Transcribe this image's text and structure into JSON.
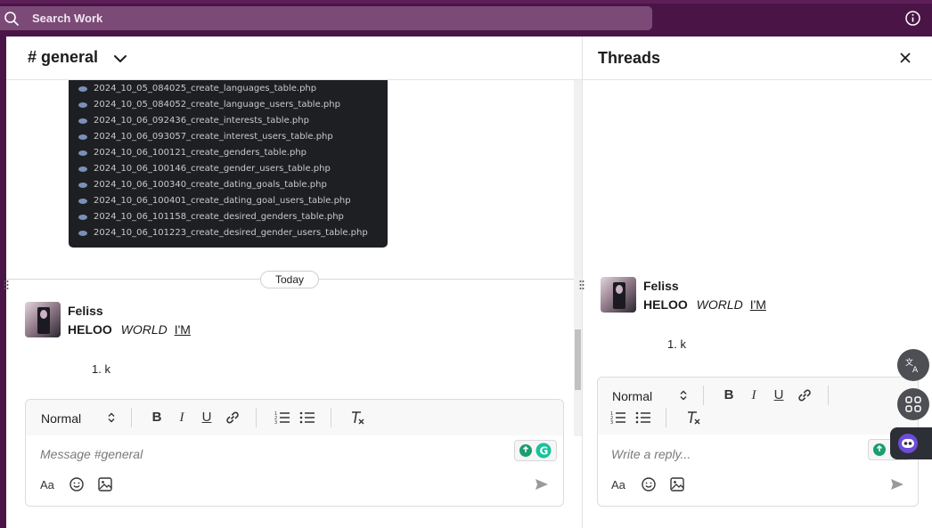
{
  "topbar": {
    "search_placeholder": "Search Work",
    "search_icon": "search-icon",
    "info_icon": "info-icon"
  },
  "channel": {
    "title": "# general"
  },
  "code_files": [
    "2024_10_05_084025_create_languages_table.php",
    "2024_10_05_084052_create_language_users_table.php",
    "2024_10_06_092436_create_interests_table.php",
    "2024_10_06_093057_create_interest_users_table.php",
    "2024_10_06_100121_create_genders_table.php",
    "2024_10_06_100146_create_gender_users_table.php",
    "2024_10_06_100340_create_dating_goals_table.php",
    "2024_10_06_100401_create_dating_goal_users_table.php",
    "2024_10_06_101158_create_desired_genders_table.php",
    "2024_10_06_101223_create_desired_gender_users_table.php"
  ],
  "date_divider": "Today",
  "message": {
    "author": "Feliss",
    "bold": "HELOO",
    "italic": "WORLD",
    "underline": "I'M",
    "list_item": "1. k"
  },
  "composer": {
    "format": "Normal",
    "placeholder": "Message #general",
    "aa_label": "Aa"
  },
  "threads": {
    "title": "Threads",
    "message": {
      "author": "Feliss",
      "bold": "HELOO",
      "italic": "WORLD",
      "underline": "I'M",
      "list_item": "1. k"
    },
    "composer": {
      "format": "Normal",
      "placeholder": "Write a reply...",
      "aa_label": "Aa"
    }
  },
  "colors": {
    "sidebar": "#4a1546",
    "search": "#7b4a77",
    "accent_green": "#1a9e6e"
  }
}
